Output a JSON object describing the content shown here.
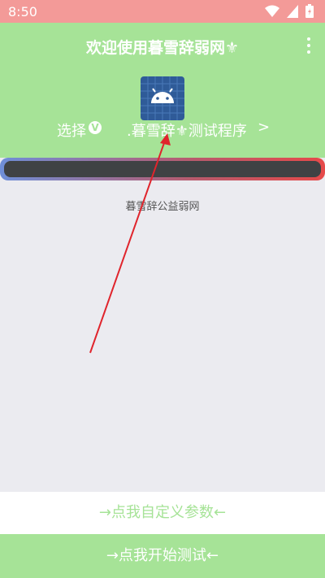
{
  "status": {
    "time": "8:50",
    "icons": [
      "wifi-icon",
      "signal-icon",
      "battery-icon"
    ]
  },
  "header": {
    "title": "欢迎使用暮雪辞弱网⚜",
    "menu_icon": "more-vert-icon"
  },
  "app": {
    "icon": "android-icon",
    "select_label": "选择",
    "badge": "V",
    "name": ".暮雪辞⚜测试程序",
    "chevron": ">"
  },
  "progress": {
    "percent": 0
  },
  "content": {
    "caption": "暮雪辞公益弱网"
  },
  "buttons": {
    "custom": "→点我自定义参数←",
    "start": "→点我开始测试←"
  },
  "colors": {
    "accent": "#a6e397",
    "status_bar": "#f39a98",
    "annotation": "#e0242c"
  }
}
